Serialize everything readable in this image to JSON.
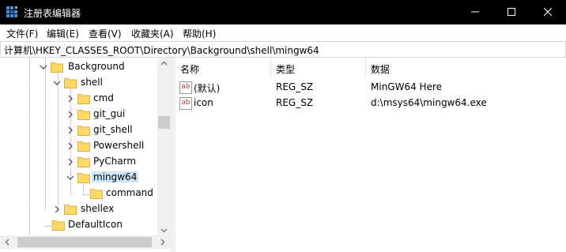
{
  "window": {
    "title": "注册表编辑器"
  },
  "menu": [
    {
      "label": "文件(F)"
    },
    {
      "label": "编辑(E)"
    },
    {
      "label": "查看(V)"
    },
    {
      "label": "收藏夹(A)"
    },
    {
      "label": "帮助(H)"
    }
  ],
  "address": "计算机\\HKEY_CLASSES_ROOT\\Directory\\Background\\shell\\mingw64",
  "tree": [
    {
      "label": "Background",
      "chevron": "down",
      "selected": false
    },
    {
      "label": "shell",
      "chevron": "down",
      "selected": false
    },
    {
      "label": "cmd",
      "chevron": "right",
      "selected": false
    },
    {
      "label": "git_gui",
      "chevron": "right",
      "selected": false
    },
    {
      "label": "git_shell",
      "chevron": "right",
      "selected": false
    },
    {
      "label": "Powershell",
      "chevron": "right",
      "selected": false
    },
    {
      "label": "PyCharm",
      "chevron": "right",
      "selected": false
    },
    {
      "label": "mingw64",
      "chevron": "down",
      "selected": true
    },
    {
      "label": "command",
      "chevron": "none",
      "selected": false
    },
    {
      "label": "shellex",
      "chevron": "right",
      "selected": false
    },
    {
      "label": "DefaultIcon",
      "chevron": "none",
      "selected": false
    }
  ],
  "list": {
    "columns": [
      "名称",
      "类型",
      "数据"
    ],
    "rows": [
      {
        "icon": "string-value-icon",
        "name": "(默认)",
        "type": "REG_SZ",
        "data": "MinGW64 Here"
      },
      {
        "icon": "string-value-icon",
        "name": "icon",
        "type": "REG_SZ",
        "data": "d:\\msys64\\mingw64.exe"
      }
    ]
  },
  "icons": {
    "app": "regedit-icon",
    "minimize": "minimize-icon",
    "maximize": "maximize-icon",
    "close": "close-icon",
    "value_badge": "ab"
  },
  "colors": {
    "titlebar": "#000000",
    "selection": "#cce8ff",
    "folder": "#ffd867"
  }
}
